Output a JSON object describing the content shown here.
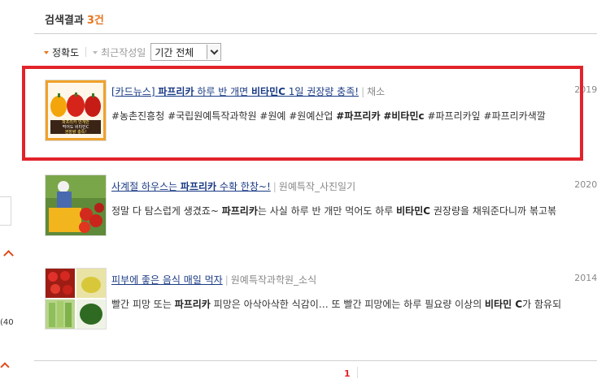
{
  "header": {
    "title": "검색결과",
    "count": "3건"
  },
  "sort": {
    "accuracy_label": "정확도",
    "recent_label": "최근작성일",
    "period_value": "기간 전체"
  },
  "results": [
    {
      "title_prefix": "[카드뉴스] ",
      "title_b1": "파프리카",
      "title_mid": " 하루 반 개면 ",
      "title_b2": "비타민C",
      "title_suffix": " 1일 권장량 충족!",
      "source": "채소",
      "date": "2019/",
      "snippet": [
        {
          "t": "#농촌진흥청 #국립원예특작과학원 #원예 #원예산업 ",
          "b": false
        },
        {
          "t": "#파프리카",
          "b": true
        },
        {
          "t": " ",
          "b": false
        },
        {
          "t": "#비타민c",
          "b": true
        },
        {
          "t": " #파프리카잎 #파프리카색깔",
          "b": false
        }
      ]
    },
    {
      "title_prefix": "사계절 하우스는 ",
      "title_b1": "파프리카",
      "title_mid": " 수확 한창~!",
      "title_b2": "",
      "title_suffix": "",
      "source": "원예특작_사진일기",
      "date": "2020/",
      "snippet": [
        {
          "t": "정말 다 탐스럽게 생겼죠~ ",
          "b": false
        },
        {
          "t": "파프리카",
          "b": true
        },
        {
          "t": "는 사실 하루 반 개만 먹어도 하루 ",
          "b": false
        },
        {
          "t": "비타민C",
          "b": true
        },
        {
          "t": " 권장량을 채워준다니까 볶고볶",
          "b": false
        }
      ]
    },
    {
      "title_prefix": "피부에 좋은 음식 매일 먹자",
      "title_b1": "",
      "title_mid": "",
      "title_b2": "",
      "title_suffix": "",
      "source": "원예특작과학원_소식",
      "date": "2014/",
      "snippet": [
        {
          "t": "빨간 피망 또는 ",
          "b": false
        },
        {
          "t": "파프리카",
          "b": true
        },
        {
          "t": " 피망은 아삭아삭한 식감이… 또 빨간 피망에는 하루 필요량 이상의 ",
          "b": false
        },
        {
          "t": "비타민 C",
          "b": true
        },
        {
          "t": "가 함유되",
          "b": false
        }
      ]
    }
  ],
  "thumb1_caption": [
    "파프리카 반개만",
    "먹어도 비타민C",
    "권장량 충족!"
  ],
  "left_panel": {
    "count_text": "(40"
  },
  "pagination": {
    "current": "1"
  },
  "colors": {
    "accent": "#e8761e",
    "highlight": "#e2232a",
    "link": "#1a3a84"
  }
}
